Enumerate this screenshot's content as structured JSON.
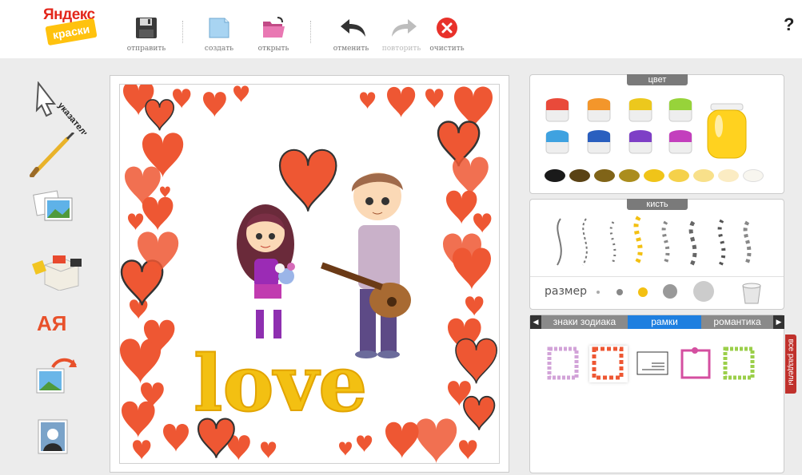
{
  "app": {
    "logo_line1": "Яндекс",
    "logo_line2": "краски",
    "help": "?"
  },
  "toolbar": {
    "send": "отправить",
    "create": "создать",
    "open": "открыть",
    "undo": "отменить",
    "redo": "повторить",
    "clear": "очистить"
  },
  "tools": {
    "pointer": "указатель",
    "pointer_icon": "cursor-icon",
    "brush_icon": "brush-icon",
    "images_icon": "images-icon",
    "stamps_icon": "stamps-icon",
    "text_icon": "text-icon",
    "text_glyph": "АЯ",
    "rotate_icon": "rotate-icon",
    "background_icon": "portrait-icon"
  },
  "canvas": {
    "love_text": "love"
  },
  "color_panel": {
    "title": "цвет",
    "paint_colors": [
      "#e94a3a",
      "#f3962b",
      "#ecc81d",
      "#97d33a",
      "#3fa2e0",
      "#2a5fbf",
      "#7e3fc6",
      "#c33fbd"
    ],
    "selected_color": "#ffd21f",
    "swatches": [
      "#1a1a1a",
      "#5a4214",
      "#806418",
      "#ab8d1d",
      "#f0c419",
      "#f5d14a",
      "#f8e08a",
      "#fbecc3",
      "#f8f6ef"
    ]
  },
  "brush_panel": {
    "title": "кисть",
    "size_label": "размер",
    "brushes": [
      "line",
      "dotted",
      "sparkle",
      "hearts",
      "flowers",
      "squares",
      "stars",
      "shells"
    ],
    "selected_brush": "hearts"
  },
  "stamp_panel": {
    "tabs": [
      "знаки зодиака",
      "рамки",
      "романтика"
    ],
    "active_tab": "рамки",
    "side_tab": "все разделы",
    "frames": [
      "frame-1",
      "frame-2",
      "frame-3",
      "frame-4",
      "frame-5"
    ],
    "frame_note": "ВАША ОТКРЫТКА"
  }
}
